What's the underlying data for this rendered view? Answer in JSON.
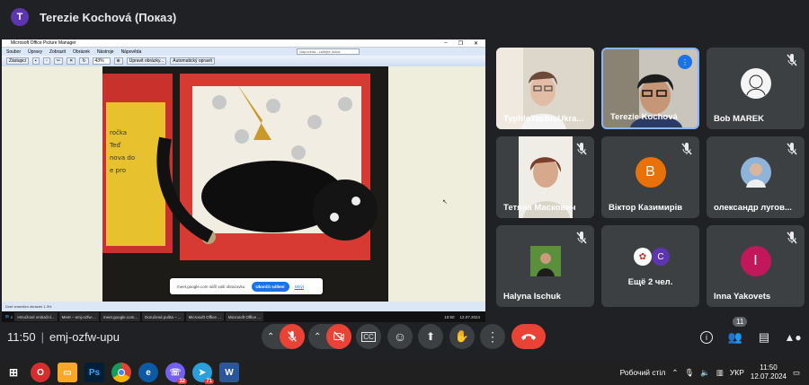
{
  "header": {
    "avatar_letter": "T",
    "presenter": "Terezie Kochová (Показ)"
  },
  "pm": {
    "title": "Microsoft Office Picture Manager",
    "menu": [
      "Soubor",
      "Úpravy",
      "Zobrazit",
      "Obrázek",
      "Nástroje",
      "Nápověda"
    ],
    "help_placeholder": "Nápověda - zadejte dotaz",
    "tools": {
      "shortcuts": "Zástupci",
      "zoom": "43%",
      "edit": "Upravit obrázky...",
      "auto": "Automatický opravit"
    },
    "status": "Dveř zmenšen obrázek 1.3%",
    "banner_text": "meet.google.com sdílí vaši obrazovku.",
    "banner_stop": "Ukončit sdílení",
    "banner_hide": "Skrýt"
  },
  "inner_taskbar": {
    "items": [
      "Hrnožové vnitrační...",
      "Meet – emj-ozfw-...",
      "meet.google.com...",
      "Doručená pošta – ...",
      "Microsoft Office ...",
      "Microsoft Office ..."
    ],
    "time": "10:50",
    "date": "12.07.2024"
  },
  "participants": [
    {
      "name": "TyphloTactusUkra...",
      "type": "video",
      "muted": false
    },
    {
      "name": "Terezie Kochová",
      "type": "video",
      "speaking": true
    },
    {
      "name": "Bob MAREK",
      "type": "avatar",
      "muted": true
    },
    {
      "name": "Тетяна Маскович",
      "type": "video",
      "muted": true
    },
    {
      "name": "Віктор Казимирів",
      "type": "letter",
      "letter": "В",
      "color": "#e8710a",
      "muted": true
    },
    {
      "name": "олександр лугов...",
      "type": "avatar",
      "muted": true
    },
    {
      "name": "Halyna Ischuk",
      "type": "avatar",
      "muted": true
    },
    {
      "name": "Ещё 2 чел.",
      "type": "group",
      "letter": "C",
      "color": "#5e35b1"
    },
    {
      "name": "Inna Yakovets",
      "type": "letter",
      "letter": "I",
      "color": "#c2185b",
      "muted": true
    }
  ],
  "meeting": {
    "time": "11:50",
    "code": "emj-ozfw-upu",
    "people_count": "11"
  },
  "controls": [
    "raise-mic-menu",
    "mic-off",
    "raise-cam-menu",
    "cam-off",
    "captions",
    "emoji",
    "present",
    "raise-hand",
    "more",
    "leave"
  ],
  "windows": {
    "desktop_label": "Робочий стіл",
    "lang": "УКР",
    "time": "11:50",
    "date": "12.07.2024",
    "badges": {
      "viber": "32",
      "telegram": "71"
    }
  },
  "colors": {
    "bg": "#202124",
    "tile": "#3c4043",
    "leave": "#ea4335",
    "mic_off": "#ea4335",
    "accent": "#1a73e8"
  }
}
